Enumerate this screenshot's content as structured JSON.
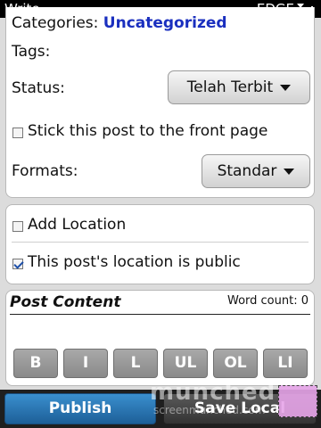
{
  "status_bar": {
    "app_title": "Write",
    "network": "EDGE"
  },
  "post": {
    "categories_label": "Categories:",
    "categories_value": "Uncategorized",
    "tags_label": "Tags:",
    "status_label": "Status:",
    "status_value": "Telah Terbit",
    "sticky_label": "Stick this post to the front page",
    "sticky_checked": false,
    "formats_label": "Formats:",
    "format_value": "Standar"
  },
  "location": {
    "add_label": "Add Location",
    "add_checked": false,
    "public_label": "This post's location is public",
    "public_checked": true
  },
  "content": {
    "title": "Post Content",
    "word_count": "Word count: 0",
    "format_buttons": [
      "B",
      "I",
      "L",
      "UL",
      "OL",
      "LI"
    ]
  },
  "actions": {
    "publish": "Publish",
    "save_local": "Save Local"
  },
  "watermark": {
    "main": "munched",
    "sub": "screenmunched.com"
  },
  "colors": {
    "accent": "#1d5f98",
    "link": "#1a2fbf"
  }
}
